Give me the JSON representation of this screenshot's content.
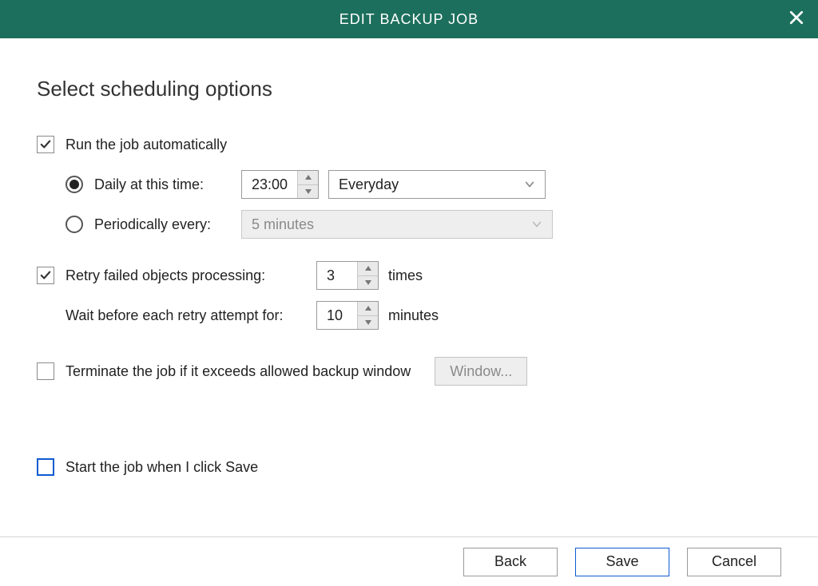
{
  "titlebar": {
    "title": "EDIT BACKUP JOB"
  },
  "section_title": "Select scheduling options",
  "run_auto": {
    "label": "Run the job automatically",
    "checked": true,
    "daily": {
      "label": "Daily at this time:",
      "selected": true,
      "time": "23:00",
      "recurrence": "Everyday"
    },
    "periodic": {
      "label": "Periodically every:",
      "selected": false,
      "interval": "5 minutes"
    }
  },
  "retry": {
    "label": "Retry failed objects processing:",
    "checked": true,
    "count": "3",
    "count_suffix": "times",
    "wait_label": "Wait before each retry attempt for:",
    "wait_value": "10",
    "wait_suffix": "minutes"
  },
  "terminate": {
    "label": "Terminate the job if it exceeds allowed backup window",
    "checked": false,
    "button": "Window..."
  },
  "start_now": {
    "label": "Start the job when I click Save",
    "checked": false
  },
  "footer": {
    "back": "Back",
    "save": "Save",
    "cancel": "Cancel"
  }
}
